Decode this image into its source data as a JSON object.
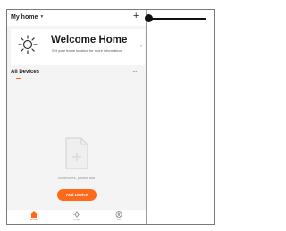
{
  "colors": {
    "accent": "#ff6a1a",
    "text_primary": "#1c1c1c",
    "text_muted": "#9a9a9a"
  },
  "header": {
    "home_name": "My home",
    "add_icon": "plus-icon"
  },
  "welcome": {
    "title": "Welcome Home",
    "subtitle": "Set your home location for more information",
    "icon": "sun-icon"
  },
  "devices": {
    "tab_title": "All Devices",
    "more_icon": "more-icon",
    "empty_text": "No devices, please add",
    "add_button_label": "Add Device"
  },
  "tabbar": {
    "tabs": [
      {
        "label": "Home",
        "icon": "home-icon",
        "active": true
      },
      {
        "label": "Smart",
        "icon": "smart-icon",
        "active": false
      },
      {
        "label": "Me",
        "icon": "profile-icon",
        "active": false
      }
    ]
  }
}
